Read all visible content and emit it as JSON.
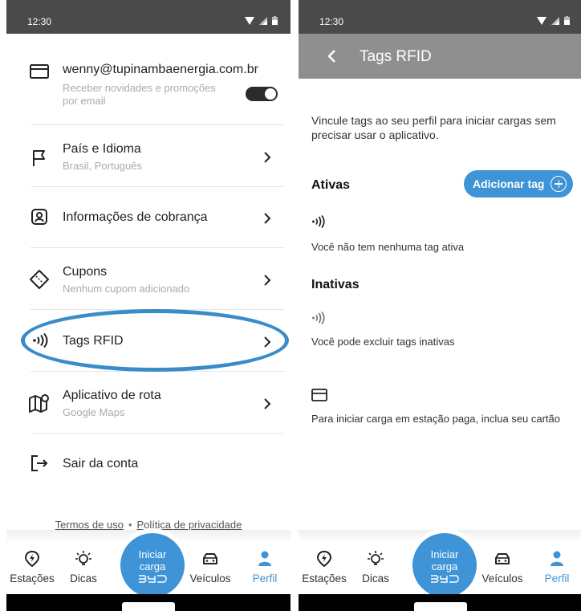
{
  "status_bar": {
    "time": "12:30"
  },
  "settings": {
    "account": {
      "email": "wenny@tupinambaenergia.com.br",
      "newsletter_label": "Receber novidades e promoções por email",
      "newsletter_enabled": true
    },
    "items": [
      {
        "title": "País e Idioma",
        "subtitle": "Brasil, Português",
        "icon": "flag-icon"
      },
      {
        "title": "Informações de cobrança",
        "subtitle": "",
        "icon": "billing-user-icon"
      },
      {
        "title": "Cupons",
        "subtitle": "Nenhum cupom adicionado",
        "icon": "coupon-icon"
      },
      {
        "title": "Tags RFID",
        "subtitle": "",
        "icon": "rfid-icon",
        "highlighted": true
      },
      {
        "title": "Aplicativo de rota",
        "subtitle": "Google Maps",
        "icon": "map-icon"
      },
      {
        "title": "Sair da conta",
        "subtitle": "",
        "icon": "logout-icon"
      }
    ],
    "footer": {
      "terms": "Termos de uso",
      "separator": "•",
      "privacy": "Política de privacidade"
    }
  },
  "rfid": {
    "title": "Tags RFID",
    "intro": "Vincule tags ao seu perfil para iniciar cargas sem precisar usar o aplicativo.",
    "active_heading": "Ativas",
    "add_tag_label": "Adicionar tag",
    "active_empty": "Você não tem nenhuma tag ativa",
    "inactive_heading": "Inativas",
    "inactive_info": "Você pode excluir tags inativas",
    "card_info": "Para iniciar carga em estação paga, inclua seu cartão"
  },
  "bottom_nav": {
    "items": [
      "Estações",
      "Dicas",
      "Veículos",
      "Perfil"
    ],
    "center_line1": "Iniciar",
    "center_line2": "carga",
    "active": "Perfil"
  },
  "colors": {
    "accent": "#3e94d6",
    "status_bar": "#4a4a4a",
    "app_bar": "#8f8f8f",
    "highlight_ring": "#3a8cc9"
  }
}
